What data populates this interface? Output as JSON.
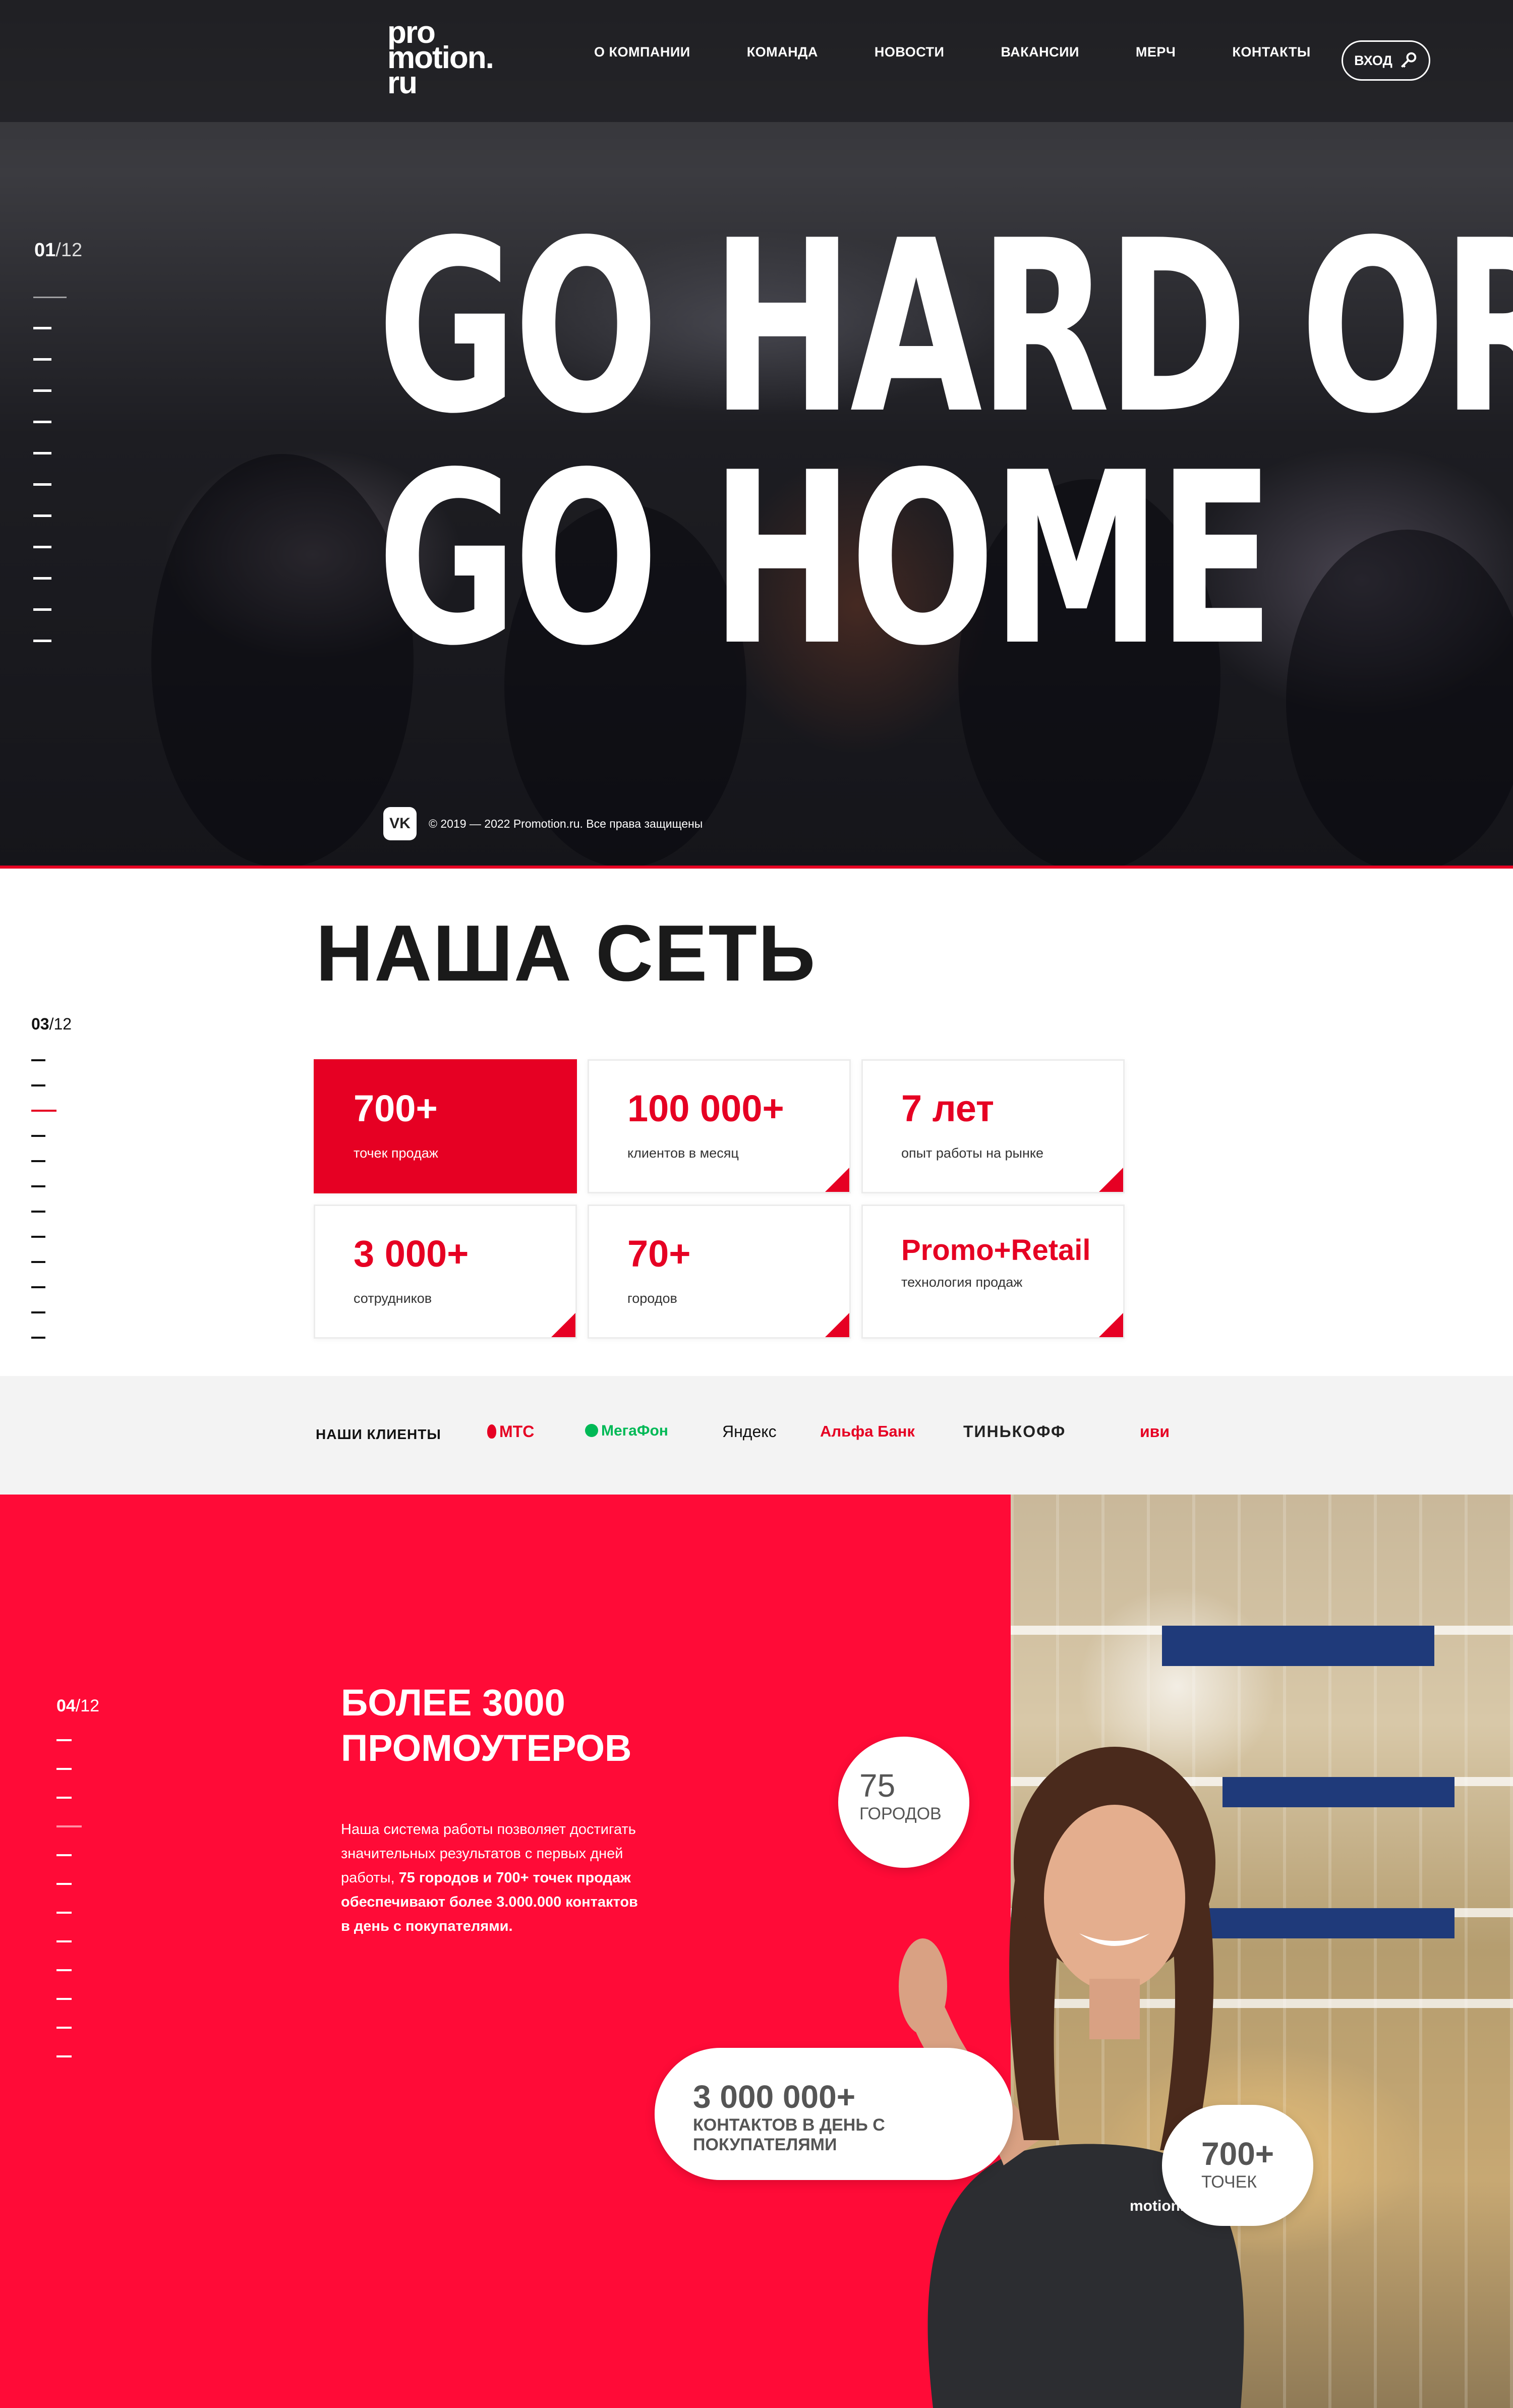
{
  "header": {
    "logo": [
      "pro",
      "motion.",
      "ru"
    ],
    "nav": [
      "О КОМПАНИИ",
      "КОМАНДА",
      "НОВОСТИ",
      "ВАКАНСИИ",
      "МЕРЧ",
      "КОНТАКТЫ"
    ],
    "login_label": "ВХОД"
  },
  "hero": {
    "counter_current": "01",
    "counter_total": "/12",
    "title_line1": "GO HARD OR",
    "title_line2": "GO HOME",
    "copyright": "© 2019 — 2022 Promotion.ru. Все права защищены",
    "vk_label": "VK"
  },
  "network": {
    "title": "НАША СЕТЬ",
    "counter_current": "03",
    "counter_total": "/12",
    "stats": [
      {
        "value": "700+",
        "label": "точек продаж"
      },
      {
        "value": "100 000+",
        "label": "клиентов в месяц"
      },
      {
        "value": "7 лет",
        "label": "опыт работы на рынке"
      },
      {
        "value": "3 000+",
        "label": "сотрудников"
      },
      {
        "value": "70+",
        "label": "городов"
      },
      {
        "value": "Promo+Retail",
        "label": "технология продаж"
      }
    ]
  },
  "clients": {
    "label": "НАШИ КЛИЕНТЫ",
    "items": [
      "МТС",
      "МегаФон",
      "Яндекс",
      "Альфа Банк",
      "ТИНЬКОФФ",
      "иви"
    ]
  },
  "promo": {
    "counter_current": "04",
    "counter_total": "/12",
    "title_line1": "БОЛЕЕ 3000",
    "title_line2": "ПРОМОУТЕРОВ",
    "text_part1": "Наша система работы позволяет достигать значительных результатов с первых дней работы, ",
    "text_bold": "75 городов и 700+ точек продаж обеспечивают более 3.000.000 контактов в день с покупателями.",
    "bubble_cities_value": "75",
    "bubble_cities_label": "ГОРОДОВ",
    "bubble_contacts_value": "3 000 000+",
    "bubble_contacts_label": "КОНТАКТОВ В ДЕНЬ С ПОКУПАТЕЛЯМИ",
    "bubble_points_value": "700+",
    "bubble_points_label": "ТОЧЕК",
    "shirt_text": "motion."
  },
  "colors": {
    "accent": "#e60023",
    "promo_bg": "#ff0b37"
  }
}
